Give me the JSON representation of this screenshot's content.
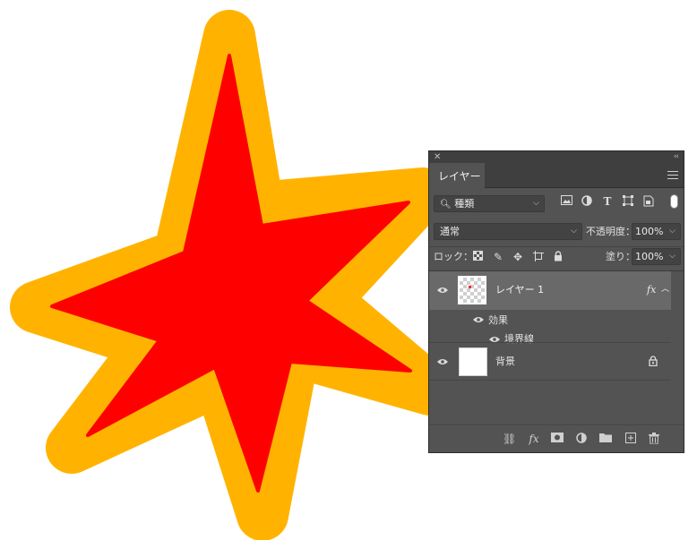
{
  "colors": {
    "star_fill": "#ff0000",
    "stroke_orange": "#ffb300",
    "panel_bg": "#535353",
    "selected_layer_bg": "#696969"
  },
  "panel": {
    "close_icon": "close-icon",
    "collapse_icon": "double-chevron-icon",
    "tab_label": "レイヤー",
    "menu_icon": "hamburger-menu-icon",
    "filter": {
      "kind_label": "種類",
      "icons": [
        "image-filter-icon",
        "adjustment-filter-icon",
        "type-filter-icon",
        "shape-filter-icon",
        "smart-object-filter-icon"
      ]
    },
    "blend_mode": "通常",
    "opacity_label": "不透明度：",
    "opacity_value": "100%",
    "lock_label": "ロック：",
    "fill_label": "塗り：",
    "fill_value": "100%",
    "layers": [
      {
        "name": "レイヤー 1",
        "visible": true,
        "selected": true,
        "fx_badge": "fx",
        "effects_label": "効果",
        "effects": [
          "境界線"
        ]
      },
      {
        "name": "背景",
        "visible": true,
        "selected": false,
        "locked": true
      }
    ],
    "bottom_icons": [
      "link-layers-icon",
      "add-layer-style-icon",
      "add-mask-icon",
      "new-adjustment-layer-icon",
      "new-group-icon",
      "new-layer-icon",
      "delete-layer-icon"
    ],
    "bottom_fx_label": "fx"
  }
}
